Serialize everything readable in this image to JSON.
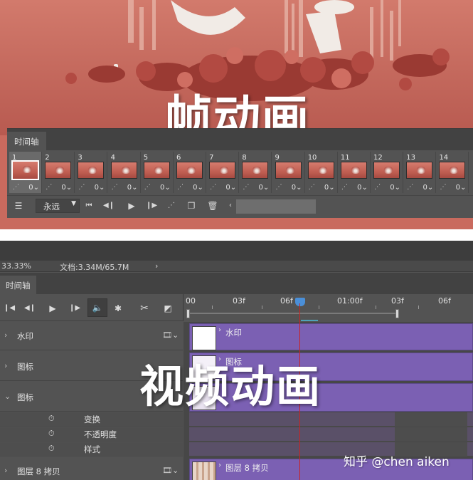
{
  "top": {
    "title": "帧动画",
    "panel_tab": "时间轴",
    "frames": [
      {
        "num": "1",
        "delay": "0",
        "selected": true
      },
      {
        "num": "2",
        "delay": "0",
        "selected": false
      },
      {
        "num": "3",
        "delay": "0",
        "selected": false
      },
      {
        "num": "4",
        "delay": "0",
        "selected": false
      },
      {
        "num": "5",
        "delay": "0",
        "selected": false
      },
      {
        "num": "6",
        "delay": "0",
        "selected": false
      },
      {
        "num": "7",
        "delay": "0",
        "selected": false
      },
      {
        "num": "8",
        "delay": "0",
        "selected": false
      },
      {
        "num": "9",
        "delay": "0",
        "selected": false
      },
      {
        "num": "10",
        "delay": "0",
        "selected": false
      },
      {
        "num": "11",
        "delay": "0",
        "selected": false
      },
      {
        "num": "12",
        "delay": "0",
        "selected": false
      },
      {
        "num": "13",
        "delay": "0",
        "selected": false
      },
      {
        "num": "14",
        "delay": "0",
        "selected": false
      }
    ],
    "loop_option": "永远"
  },
  "bottom": {
    "title": "视频动画",
    "zoom": "33.33%",
    "doc_info": "文档:3.34M/65.7M",
    "panel_tab": "时间轴",
    "ruler_labels": [
      "00",
      "03f",
      "06f",
      "01:00f",
      "03f",
      "06f"
    ],
    "layers": [
      {
        "name": "水印",
        "clip_label": "水印"
      },
      {
        "name": "图标",
        "clip_label": "图标"
      },
      {
        "name": "图标",
        "clip_label": ""
      },
      {
        "name": "图层 8 拷贝",
        "clip_label": "图层 8 拷贝"
      }
    ],
    "properties": [
      "变换",
      "不透明度",
      "样式"
    ]
  },
  "watermark": "知乎 @chen aiken",
  "colors": {
    "panel": "#535353",
    "panel_dark": "#424242",
    "clip": "#7b60b3",
    "playhead": "#4a8fd8",
    "playhead_line": "#cc2222",
    "scene": "#c96a5e"
  }
}
